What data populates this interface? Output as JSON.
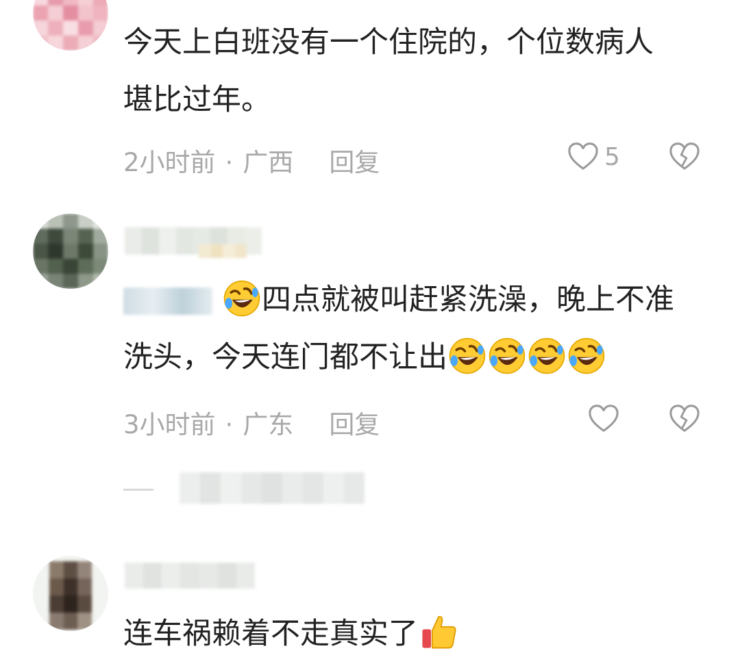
{
  "comments": [
    {
      "text_line1": "今天上白班没有一个住院的，个位数病人",
      "text_line2": "堪比过年。",
      "time": "2小时前",
      "separator": "·",
      "location": "广西",
      "reply_label": "回复",
      "like_count": "5"
    },
    {
      "text_line1": "四点就被叫赶紧洗澡，晚上不准",
      "text_line2": "洗头，今天连门都不让出",
      "time": "3小时前",
      "separator": "·",
      "location": "广东",
      "reply_label": "回复"
    },
    {
      "text": "连车祸赖着不走真实了"
    }
  ],
  "icons": {
    "like": "heart-outline-icon",
    "dislike": "broken-heart-icon",
    "laugh": "rolling-on-floor-laughing-emoji",
    "thumbs_up": "thumbs-up-emoji"
  },
  "colors": {
    "text": "#222222",
    "meta": "#a8a8a8",
    "icon": "#9a9a9a"
  }
}
